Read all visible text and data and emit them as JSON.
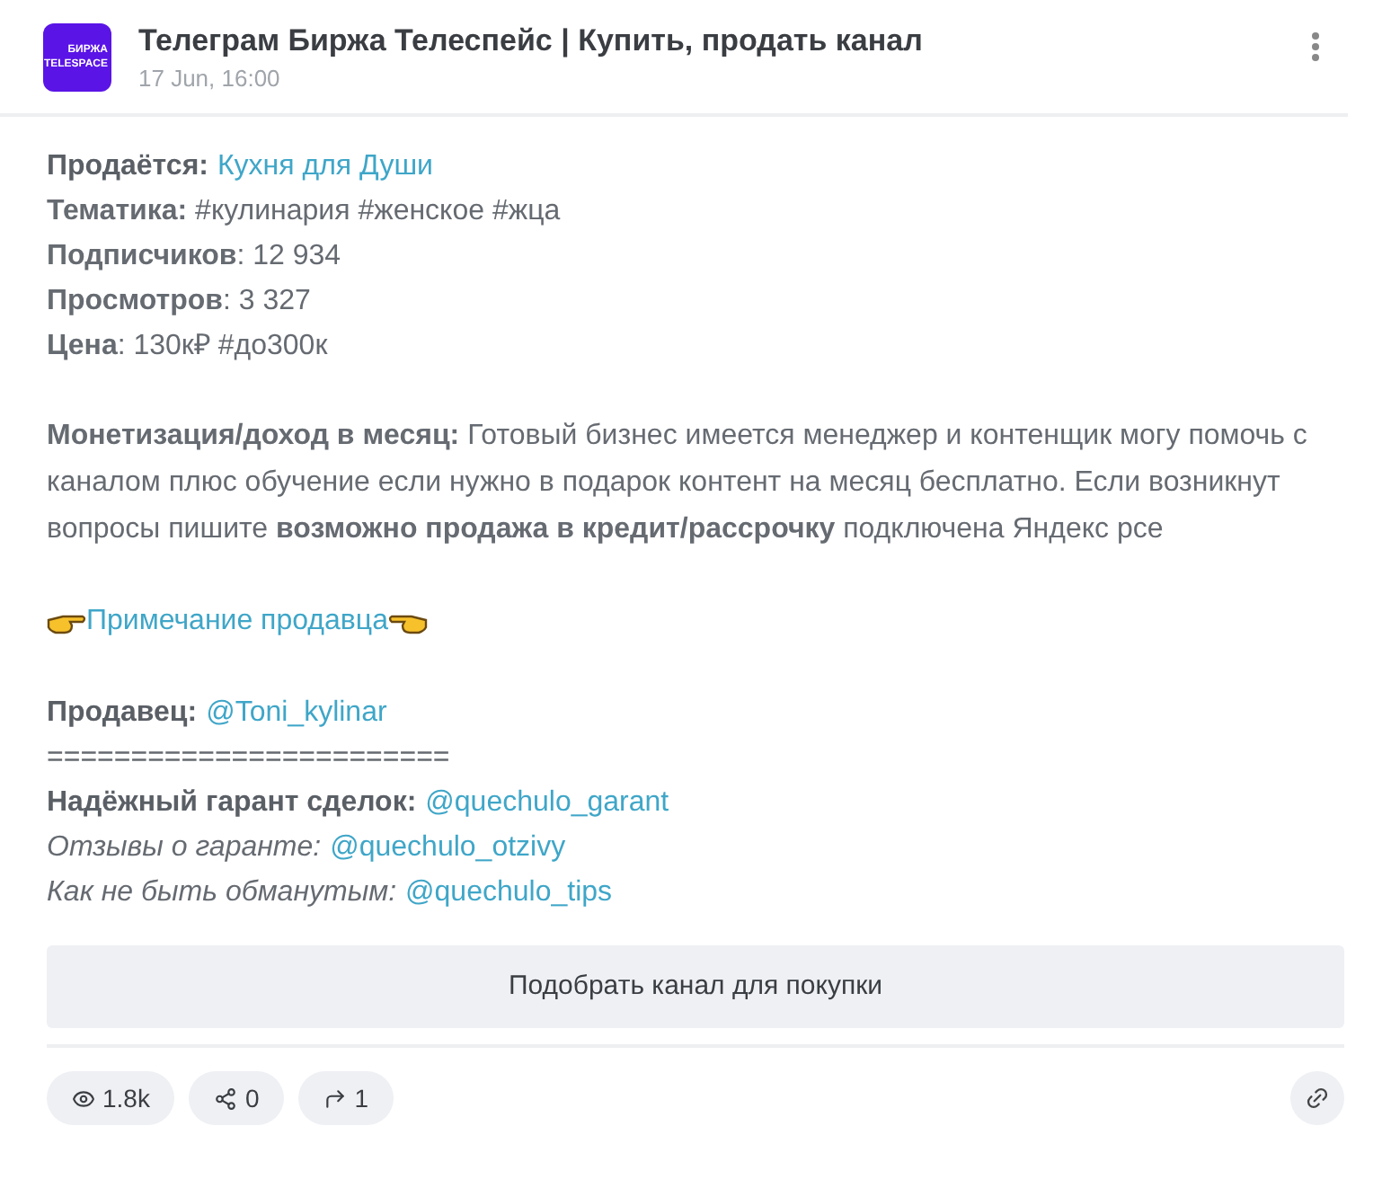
{
  "header": {
    "logo_text": [
      "БИРЖА",
      "TELESPACE"
    ],
    "title": "Телеграм Биржа Телеспейс | Купить, продать канал",
    "date": "17 Jun, 16:00"
  },
  "fields": [
    {
      "kind": "link",
      "label": "Продаётся:",
      "value": "Кухня для Души",
      "italic": false
    },
    {
      "kind": "text",
      "text": "**Тематика:** #кулинария #женское #жца"
    },
    {
      "kind": "text",
      "text": "**Подписчиков**: 12 934"
    },
    {
      "kind": "text",
      "text": "**Просмотров**: 3 327"
    },
    {
      "kind": "text",
      "text": "**Цена**: 130к₽ #до300к"
    }
  ],
  "description": "**Монетизация/доход в месяц:** Готовый бизнес имеется менеджер и контенщик могу помочь с каналом плюс обучение если нужно в подарок контент на месяц бесплатно. Если возникнут вопросы пишите **возможно продажа в кредит/рассрочку** подключена Яндекс рсе",
  "note_link": "Примечание продавца",
  "contacts": [
    {
      "kind": "link",
      "label": "Продавец:",
      "value": "@Toni_kylinar",
      "italic": false
    },
    {
      "kind": "separator",
      "value": "========================"
    },
    {
      "kind": "link",
      "label": "Надёжный гарант сделок:",
      "value": "@quechulo_garant",
      "italic": false
    },
    {
      "kind": "link",
      "label": "Отзывы о гаранте:",
      "value": "@quechulo_otzivy",
      "italic": true
    },
    {
      "kind": "link",
      "label": "Как не быть обманутым:",
      "value": "@quechulo_tips",
      "italic": true
    }
  ],
  "action_button": "Подобрать канал для покупки",
  "stats": [
    {
      "kind": "views",
      "value": "1.8k"
    },
    {
      "kind": "shares",
      "value": "0"
    },
    {
      "kind": "forwards",
      "value": "1"
    }
  ]
}
